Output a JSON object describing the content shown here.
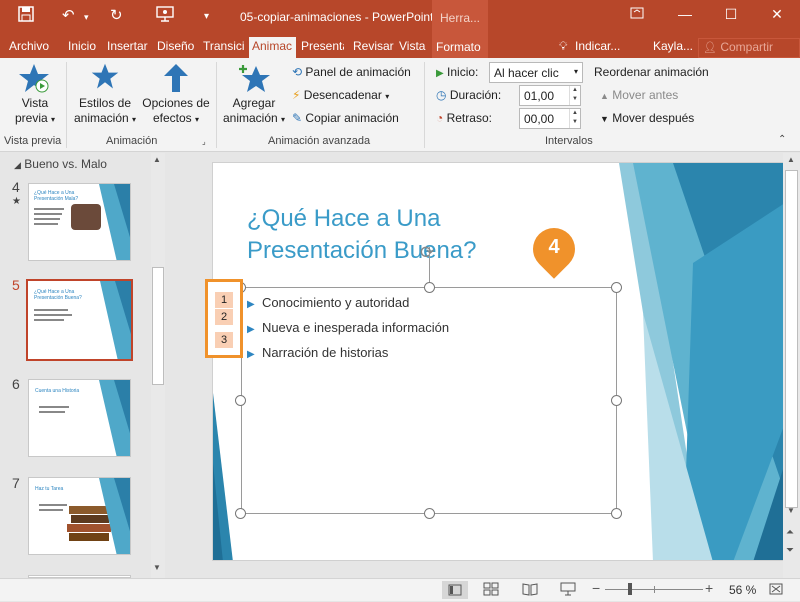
{
  "titlebar": {
    "doc_title": "05-copiar-animaciones - PowerPoint",
    "contextual_tab": "Herra...",
    "colors": {
      "accent": "#b7472a"
    }
  },
  "tabs": [
    {
      "label": "Archivo"
    },
    {
      "label": "Inicio"
    },
    {
      "label": "Insertar"
    },
    {
      "label": "Diseño"
    },
    {
      "label": "Transici"
    },
    {
      "label": "Animac"
    },
    {
      "label": "Presenta"
    },
    {
      "label": "Revisar"
    },
    {
      "label": "Vista"
    },
    {
      "label": "Formato"
    }
  ],
  "tabbar_right": {
    "tell_me": "Indicar...",
    "user": "Kayla...",
    "share": "Compartir"
  },
  "ribbon": {
    "preview": {
      "label_line1": "Vista",
      "label_line2": "previa",
      "group": "Vista previa"
    },
    "animation": {
      "styles_line1": "Estilos de",
      "styles_line2": "animación",
      "options_line1": "Opciones de",
      "options_line2": "efectos",
      "group": "Animación"
    },
    "advanced": {
      "add_line1": "Agregar",
      "add_line2": "animación",
      "panel": "Panel de animación",
      "trigger": "Desencadenar",
      "copy": "Copiar animación",
      "group": "Animación avanzada"
    },
    "timing": {
      "start_label": "Inicio:",
      "start_value": "Al hacer clic",
      "duration_label": "Duración:",
      "duration_value": "01,00",
      "delay_label": "Retraso:",
      "delay_value": "00,00",
      "reorder": "Reordenar animación",
      "move_earlier": "Mover antes",
      "move_later": "Mover después",
      "group": "Intervalos"
    }
  },
  "leftpane": {
    "section": "Bueno vs. Malo",
    "slides": [
      {
        "num": "4",
        "title": "¿Qué Hace a Una Presentación Mala?"
      },
      {
        "num": "5",
        "title": "¿Qué Hace a Una Presentación Buena?"
      },
      {
        "num": "6",
        "title": "Cuenta una Historia"
      },
      {
        "num": "7",
        "title": "Haz tu Tarea"
      }
    ]
  },
  "slide": {
    "title_line1": "¿Qué Hace a Una",
    "title_line2": "Presentación Buena?",
    "bullets": [
      "Conocimiento y autoridad",
      "Nueva e inesperada información",
      "Narración de historias"
    ],
    "anim_tags": [
      "1",
      "2",
      "3"
    ],
    "callout": "4"
  },
  "status": {
    "zoom": "56 %"
  }
}
